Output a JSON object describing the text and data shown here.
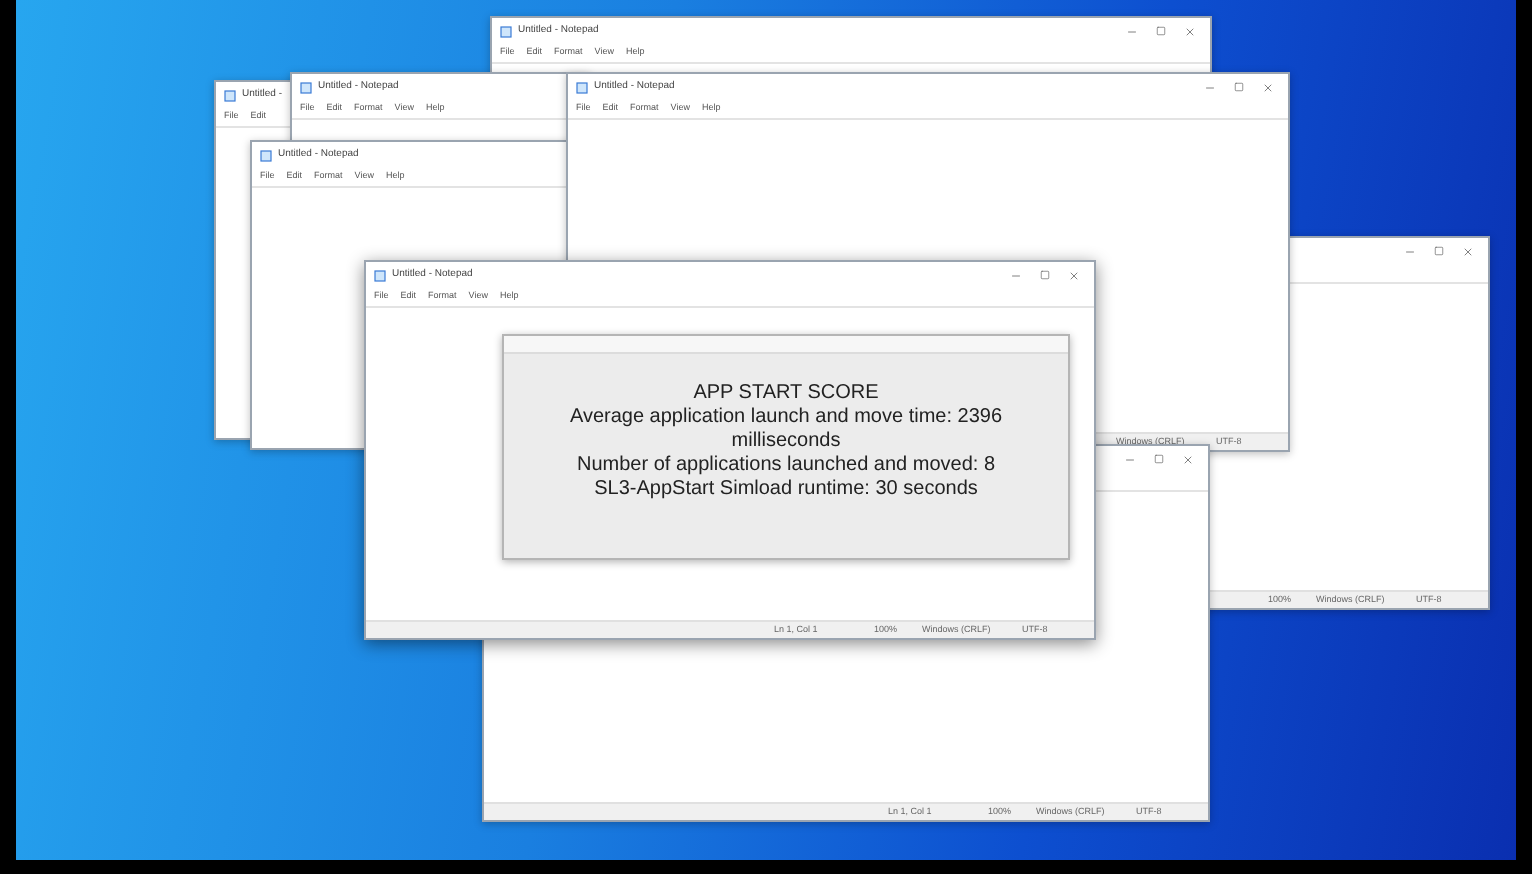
{
  "windows": [
    {
      "title": "Untitled - Notepad",
      "menu": [
        "File",
        "Edit",
        "Format",
        "View",
        "Help"
      ],
      "controls": true
    },
    {
      "title": "Untitled -",
      "menu": [
        "File",
        "Edit"
      ],
      "controls": false
    },
    {
      "title": "Untitled - Notepad",
      "menu": [
        "File",
        "Edit",
        "Format",
        "View",
        "Help"
      ],
      "controls": false
    },
    {
      "title": "Untitled - Notepad",
      "menu": [
        "File",
        "Edit",
        "Format",
        "View",
        "Help"
      ],
      "controls": false
    },
    {
      "controls": true,
      "status": [
        "100%",
        "Windows (CRLF)",
        "UTF-8"
      ]
    },
    {
      "title": "Untitled - Notepad",
      "menu": [
        "File",
        "Edit",
        "Format",
        "View",
        "Help"
      ],
      "controls": true,
      "status": [
        "Windows (CRLF)",
        "UTF-8"
      ]
    },
    {
      "controls": true,
      "status": [
        "Ln 1, Col 1",
        "100%",
        "Windows (CRLF)",
        "UTF-8"
      ]
    },
    {
      "title": "Untitled - Notepad",
      "menu": [
        "File",
        "Edit",
        "Format",
        "View",
        "Help"
      ],
      "controls": true,
      "status": [
        "Ln 1, Col 1",
        "100%",
        "Windows (CRLF)",
        "UTF-8"
      ]
    }
  ],
  "dialog": {
    "lines": [
      "APP START SCORE",
      "Average application launch and move time: 2396",
      "milliseconds",
      "Number of applications launched and moved: 8",
      "SL3-AppStart Simload runtime: 30 seconds"
    ]
  }
}
